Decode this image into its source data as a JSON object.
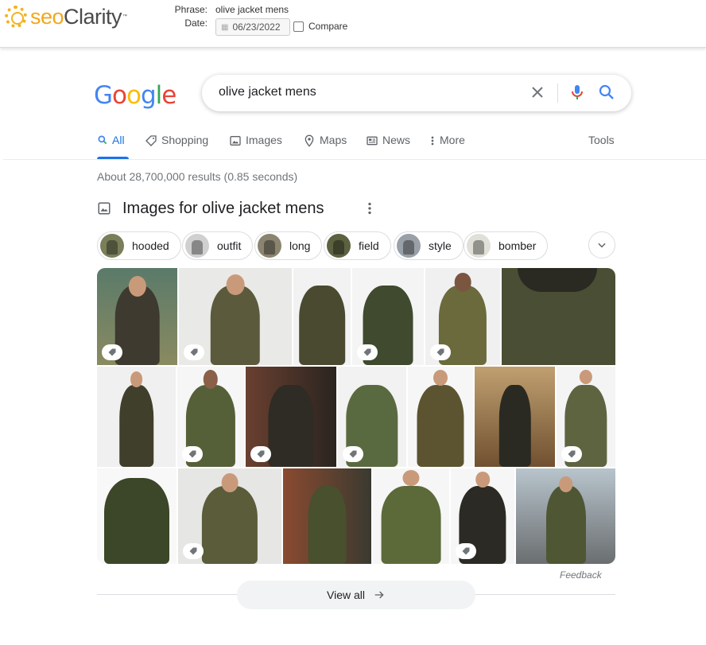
{
  "seoclarity": {
    "brand_seo": "seo",
    "brand_clarity": "Clarity",
    "brand_tm": "™",
    "phrase_label": "Phrase:",
    "phrase_value": "olive jacket mens",
    "date_label": "Date:",
    "date_value": "06/23/2022",
    "compare_label": "Compare",
    "compare_checked": false
  },
  "google": {
    "logo_letters": [
      "G",
      "o",
      "o",
      "g",
      "l",
      "e"
    ],
    "logo_colors": [
      "#4285f4",
      "#ea4335",
      "#fbbc05",
      "#4285f4",
      "#34a853",
      "#ea4335"
    ],
    "search_query": "olive jacket mens"
  },
  "tabs": [
    {
      "label": "All",
      "icon": "search-icon",
      "active": true
    },
    {
      "label": "Shopping",
      "icon": "tag-icon",
      "active": false
    },
    {
      "label": "Images",
      "icon": "image-icon",
      "active": false
    },
    {
      "label": "Maps",
      "icon": "map-pin-icon",
      "active": false
    },
    {
      "label": "News",
      "icon": "news-icon",
      "active": false
    },
    {
      "label": "More",
      "icon": "more-vertical-icon",
      "active": false
    }
  ],
  "tools_label": "Tools",
  "result_stats": "About 28,700,000 results (0.85 seconds)",
  "images_heading": "Images for olive jacket mens",
  "chips": [
    "hooded",
    "outfit",
    "long",
    "field",
    "style",
    "bomber"
  ],
  "feedback_label": "Feedback",
  "view_all_label": "View all",
  "colors": {
    "accent": "#1a73e8",
    "seo_orange": "#f3a71d",
    "jacket_olive": "#4f5a33"
  }
}
